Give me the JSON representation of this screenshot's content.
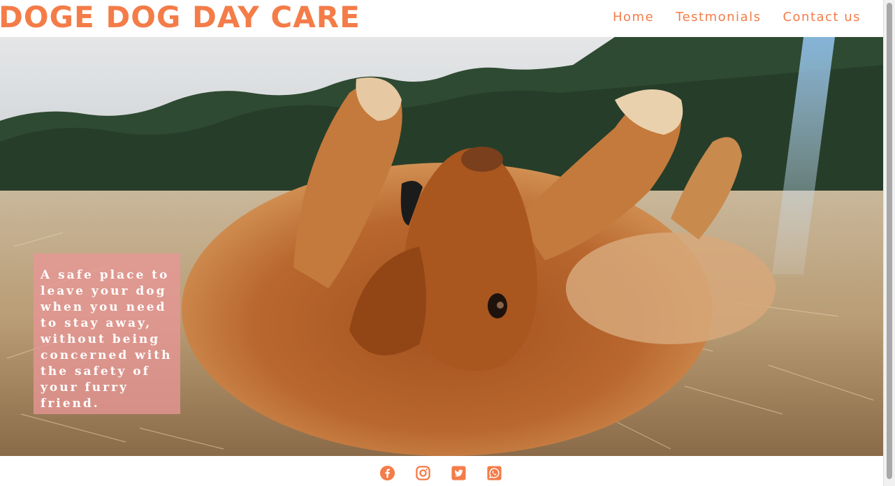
{
  "header": {
    "logo": "DOGE DOG DAY CARE",
    "nav": [
      {
        "label": "Home"
      },
      {
        "label": "Testmonials"
      },
      {
        "label": "Contact us"
      }
    ]
  },
  "hero": {
    "image_subject": "golden retriever rolling on its back in dry grass",
    "tagline": "A safe place to leave your dog when you need to stay away, without being concerned with the safety of your furry friend."
  },
  "footer": {
    "social": [
      {
        "icon": "facebook-icon"
      },
      {
        "icon": "instagram-icon"
      },
      {
        "icon": "twitter-icon"
      },
      {
        "icon": "whatsapp-icon"
      }
    ]
  },
  "colors": {
    "accent": "#f47c48",
    "tagline_bg": "#e89696",
    "tagline_text": "#ffffff"
  }
}
